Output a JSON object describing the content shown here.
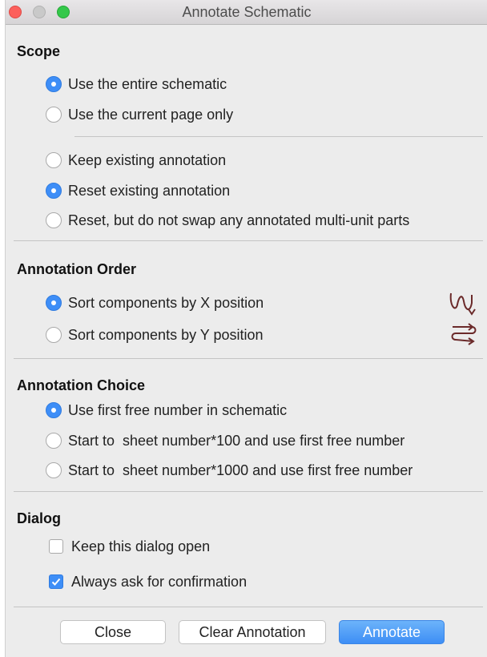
{
  "window": {
    "title": "Annotate Schematic"
  },
  "scope": {
    "heading": "Scope",
    "range_options": [
      {
        "label": "Use the entire schematic",
        "selected": true
      },
      {
        "label": "Use the current page only",
        "selected": false
      }
    ],
    "annotation_options": [
      {
        "label": "Keep existing annotation",
        "selected": false
      },
      {
        "label": "Reset existing annotation",
        "selected": true
      },
      {
        "label": "Reset, but do not swap any annotated multi-unit parts",
        "selected": false
      }
    ]
  },
  "order": {
    "heading": "Annotation Order",
    "options": [
      {
        "label": "Sort components by X position",
        "selected": true,
        "icon": "sort-x-icon"
      },
      {
        "label": "Sort components by Y position",
        "selected": false,
        "icon": "sort-y-icon"
      }
    ]
  },
  "choice": {
    "heading": "Annotation Choice",
    "options": [
      {
        "label": "Use first free number in schematic",
        "selected": true
      },
      {
        "label": "Start to  sheet number*100 and use first free number",
        "selected": false
      },
      {
        "label": "Start to  sheet number*1000 and use first free number",
        "selected": false
      }
    ]
  },
  "dialog": {
    "heading": "Dialog",
    "options": [
      {
        "label": "Keep this dialog open",
        "checked": false
      },
      {
        "label": "Always ask for confirmation",
        "checked": true
      }
    ]
  },
  "buttons": {
    "close": "Close",
    "clear": "Clear Annotation",
    "annotate": "Annotate"
  },
  "colors": {
    "accent": "#3e8ef7",
    "icon": "#6b2a2a"
  }
}
